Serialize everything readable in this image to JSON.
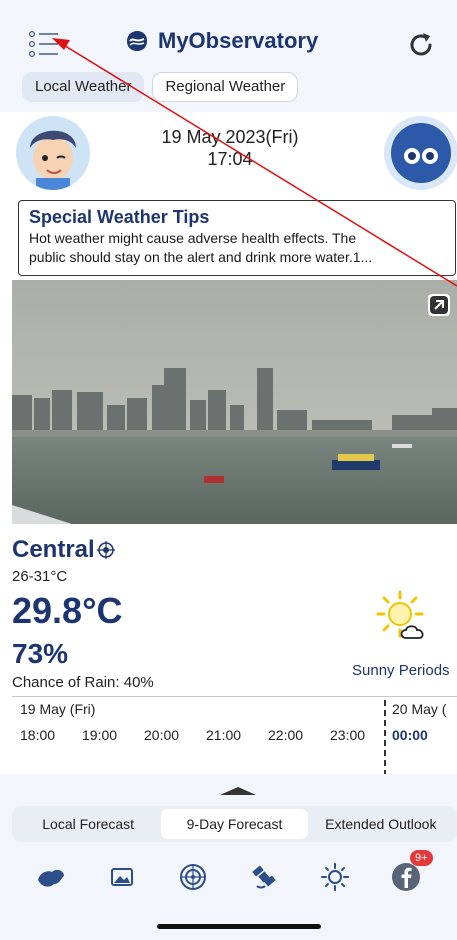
{
  "header": {
    "app_title": "MyObservatory",
    "tabs": [
      {
        "label": "Local Weather",
        "active": true
      },
      {
        "label": "Regional Weather",
        "active": false
      }
    ]
  },
  "datetime": {
    "date": "19 May 2023(Fri)",
    "time": "17:04"
  },
  "tips": {
    "title": "Special Weather Tips",
    "line1": "Hot weather might cause adverse health effects. The",
    "line2": "public should stay on the alert and drink more water.1..."
  },
  "weather": {
    "location": "Central",
    "temp_range": "26-31°C",
    "temperature": "29.8°C",
    "humidity": "73%",
    "rain": "Chance of Rain: 40%",
    "description": "Sunny Periods"
  },
  "hourly": {
    "day1": "19 May (Fri)",
    "day2": "20 May (",
    "hours": [
      "18:00",
      "19:00",
      "20:00",
      "21:00",
      "22:00",
      "23:00",
      "00:00"
    ]
  },
  "bottom_tabs": [
    {
      "label": "Local Forecast",
      "active": false
    },
    {
      "label": "9-Day Forecast",
      "active": true
    },
    {
      "label": "Extended Outlook",
      "active": false
    }
  ],
  "nav": {
    "badge": "9+",
    "icons": [
      "hk-map-icon",
      "image-gallery-icon",
      "radar-icon",
      "satellite-icon",
      "uv-sun-icon",
      "facebook-icon"
    ]
  },
  "colors": {
    "brand": "#1d3570",
    "header_bg": "#f2f6fc",
    "annotation": "#e01010",
    "badge": "#e23a3a"
  }
}
